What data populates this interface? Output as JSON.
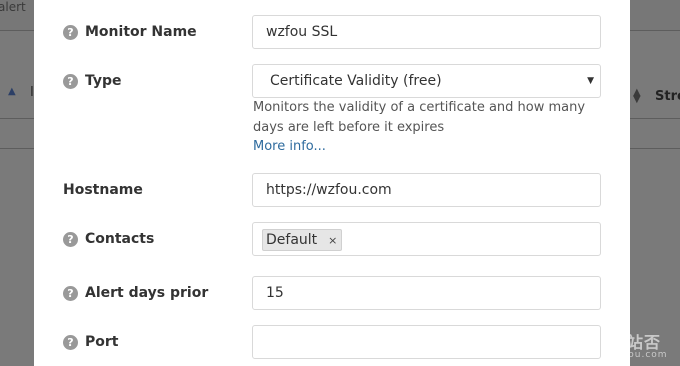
{
  "background": {
    "alert_text": "alert",
    "sort_left_icon": "sort-asc-icon",
    "letter_left": "I",
    "sort_right_icon": "sort-both-icon",
    "column_stre": "Stre"
  },
  "watermark": {
    "zh": "挖站否",
    "url": "wzfou.com"
  },
  "form": {
    "monitor_name": {
      "label": "Monitor Name",
      "value": "wzfou SSL",
      "icon": "question-icon"
    },
    "type": {
      "label": "Type",
      "value": "Certificate Validity (free)",
      "icon": "question-icon",
      "help": "Monitors the validity of a certificate and how many days are left before it expires",
      "more_info": "More info..."
    },
    "hostname": {
      "label": "Hostname",
      "value": "https://wzfou.com"
    },
    "contacts": {
      "label": "Contacts",
      "tag": "Default",
      "tag_remove": "×",
      "icon": "question-icon"
    },
    "alert_days": {
      "label": "Alert days prior",
      "value": "15",
      "icon": "question-icon"
    },
    "port": {
      "label": "Port",
      "value": "",
      "icon": "question-icon"
    }
  }
}
